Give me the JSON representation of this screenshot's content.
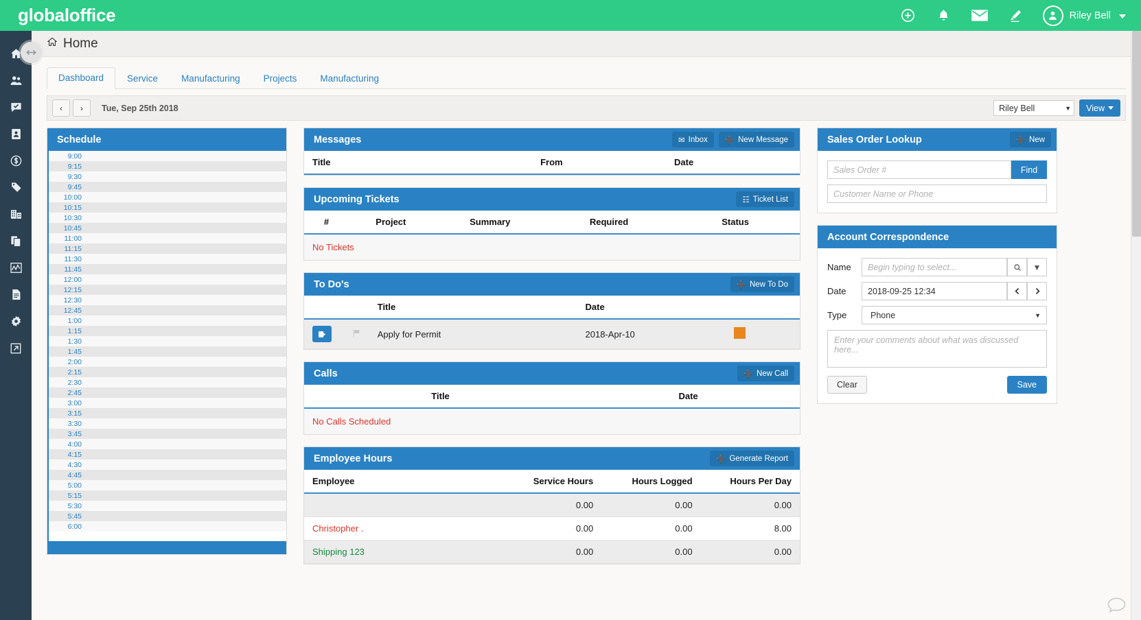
{
  "brand": "globaloffice",
  "topbar": {
    "icons": [
      {
        "name": "add-circle-icon",
        "glyph": "⊕"
      },
      {
        "name": "notifications-bell-icon",
        "glyph": "🔔"
      },
      {
        "name": "mail-envelope-icon",
        "glyph": "✉"
      },
      {
        "name": "edit-pencil-icon",
        "glyph": "✎"
      }
    ],
    "user": "Riley Bell"
  },
  "sidebar": {
    "items": [
      {
        "name": "sidebar-item-home",
        "label": "Home"
      },
      {
        "name": "sidebar-item-contacts",
        "label": "Contacts"
      },
      {
        "name": "sidebar-item-messages",
        "label": "Messages"
      },
      {
        "name": "sidebar-item-address-book",
        "label": "Address Book"
      },
      {
        "name": "sidebar-item-sales",
        "label": "Sales"
      },
      {
        "name": "sidebar-item-tags",
        "label": "Tags"
      },
      {
        "name": "sidebar-item-company",
        "label": "Company"
      },
      {
        "name": "sidebar-item-documents-copy",
        "label": "Documents"
      },
      {
        "name": "sidebar-item-reports",
        "label": "Reports"
      },
      {
        "name": "sidebar-item-files",
        "label": "Files"
      },
      {
        "name": "sidebar-item-settings",
        "label": "Settings"
      },
      {
        "name": "sidebar-item-external",
        "label": "External"
      }
    ]
  },
  "page": {
    "title": "Home"
  },
  "tabs": [
    {
      "label": "Dashboard",
      "active": true
    },
    {
      "label": "Service",
      "active": false
    },
    {
      "label": "Manufacturing",
      "active": false
    },
    {
      "label": "Projects",
      "active": false
    },
    {
      "label": "Manufacturing",
      "active": false
    }
  ],
  "toolbar": {
    "prev": "‹",
    "next": "›",
    "date": "Tue, Sep 25th 2018",
    "user_select": "Riley Bell",
    "view_button": "View"
  },
  "schedule": {
    "title": "Schedule",
    "slots": [
      "9:00",
      "9:15",
      "9:30",
      "9:45",
      "10:00",
      "10:15",
      "10:30",
      "10:45",
      "11:00",
      "11:15",
      "11:30",
      "11:45",
      "12:00",
      "12:15",
      "12:30",
      "12:45",
      "1:00",
      "1:15",
      "1:30",
      "1:45",
      "2:00",
      "2:15",
      "2:30",
      "2:45",
      "3:00",
      "3:15",
      "3:30",
      "3:45",
      "4:00",
      "4:15",
      "4:30",
      "4:45",
      "5:00",
      "5:15",
      "5:30",
      "5:45",
      "6:00"
    ]
  },
  "messages": {
    "title": "Messages",
    "inbox_button": "Inbox",
    "new_button": "New Message",
    "columns": [
      "Title",
      "From",
      "Date"
    ],
    "rows": []
  },
  "tickets": {
    "title": "Upcoming Tickets",
    "list_button": "Ticket List",
    "columns": [
      "#",
      "Project",
      "Summary",
      "Required",
      "Status"
    ],
    "empty_text": "No Tickets"
  },
  "todos": {
    "title": "To Do's",
    "new_button": "New To Do",
    "columns": [
      "Title",
      "Date"
    ],
    "rows": [
      {
        "title": "Apply for Permit",
        "date": "2018-Apr-10",
        "status_color": "#e8871e"
      }
    ]
  },
  "calls": {
    "title": "Calls",
    "new_button": "New Call",
    "columns": [
      "Title",
      "Date"
    ],
    "empty_text": "No Calls Scheduled"
  },
  "employee_hours": {
    "title": "Employee Hours",
    "report_button": "Generate Report",
    "columns": [
      "Employee",
      "Service Hours",
      "Hours Logged",
      "Hours Per Day"
    ],
    "rows": [
      {
        "employee": "",
        "service_hours": "0.00",
        "hours_logged": "0.00",
        "hours_per_day": "0.00",
        "color": "default"
      },
      {
        "employee": "Christopher .",
        "service_hours": "0.00",
        "hours_logged": "0.00",
        "hours_per_day": "8.00",
        "color": "red"
      },
      {
        "employee": "Shipping 123",
        "service_hours": "0.00",
        "hours_logged": "0.00",
        "hours_per_day": "0.00",
        "color": "green"
      }
    ]
  },
  "sales_lookup": {
    "title": "Sales Order Lookup",
    "new_button": "New",
    "order_placeholder": "Sales Order #",
    "find_button": "Find",
    "customer_placeholder": "Customer Name or Phone"
  },
  "correspondence": {
    "title": "Account Correspondence",
    "name_label": "Name",
    "name_placeholder": "Begin typing to select...",
    "date_label": "Date",
    "date_value": "2018-09-25 12:34",
    "type_label": "Type",
    "type_value": "Phone",
    "comments_placeholder": "Enter your comments about what was discussed here...",
    "clear_button": "Clear",
    "save_button": "Save"
  },
  "colors": {
    "brand_green": "#2ecc87",
    "panel_blue": "#2a82c4",
    "sidebar_dark": "#2b4050",
    "status_orange": "#e8871e",
    "danger_red": "#d9362b"
  }
}
